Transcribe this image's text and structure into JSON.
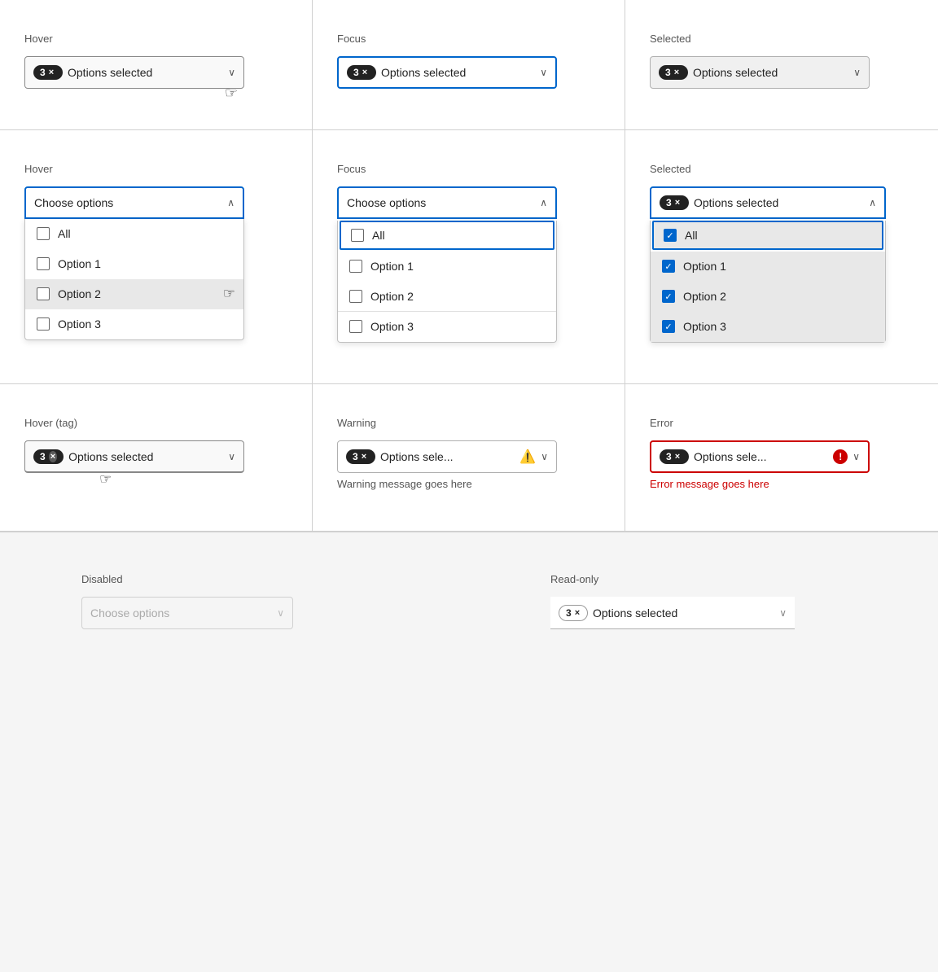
{
  "states": {
    "row1": [
      {
        "label": "Hover",
        "type": "hover",
        "badge_count": "3",
        "badge_x": "×",
        "text": "Options selected",
        "chevron": "down",
        "show_cursor": true
      },
      {
        "label": "Focus",
        "type": "focus",
        "badge_count": "3",
        "badge_x": "×",
        "text": "Options selected",
        "chevron": "down",
        "show_cursor": false
      },
      {
        "label": "Selected",
        "type": "selected",
        "badge_count": "3",
        "badge_x": "×",
        "text": "Options selected",
        "chevron": "down",
        "show_cursor": false
      }
    ],
    "row2": [
      {
        "label": "Hover",
        "type": "hover-open",
        "placeholder": "Choose options",
        "chevron": "up",
        "options": [
          "All",
          "Option 1",
          "Option 2",
          "Option 3"
        ],
        "hovered_index": 2
      },
      {
        "label": "Focus",
        "type": "focus-open",
        "placeholder": "Choose options",
        "chevron": "up",
        "options": [
          "All",
          "Option 1",
          "Option 2",
          "Option 3"
        ],
        "focused_index": 0
      },
      {
        "label": "Selected",
        "type": "selected-open",
        "badge_count": "3",
        "badge_x": "×",
        "text": "Options selected",
        "chevron": "up",
        "options": [
          "All",
          "Option 1",
          "Option 2",
          "Option 3"
        ],
        "checked_all": true
      }
    ],
    "row3": [
      {
        "label": "Hover (tag)",
        "type": "hover-tag",
        "badge_count": "3",
        "badge_x": "×",
        "text": "Options selected",
        "chevron": "down",
        "show_cursor": true
      },
      {
        "label": "Warning",
        "type": "warning",
        "badge_count": "3",
        "badge_x": "×",
        "text": "Options sele...",
        "chevron": "down",
        "warning_msg": "Warning message goes here"
      },
      {
        "label": "Error",
        "type": "error",
        "badge_count": "3",
        "badge_x": "×",
        "text": "Options sele...",
        "chevron": "down",
        "error_msg": "Error message goes here"
      }
    ],
    "row4": [
      {
        "label": "Disabled",
        "type": "disabled",
        "placeholder": "Choose options",
        "chevron": "down"
      },
      {
        "label": "Read-only",
        "type": "readonly",
        "badge_count": "3",
        "badge_x": "×",
        "text": "Options selected",
        "chevron": "down"
      }
    ]
  }
}
